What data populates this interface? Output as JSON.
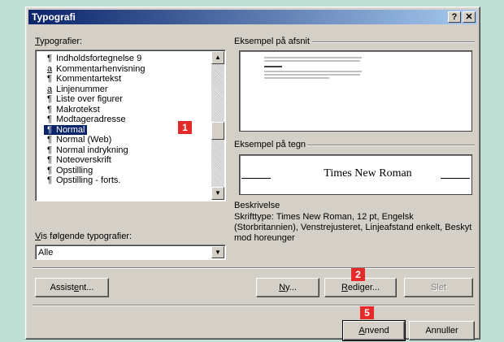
{
  "dialog": {
    "title": "Typografi",
    "help_btn": "?",
    "close_btn": "✕"
  },
  "styles_label_parts": [
    "T",
    "ypografier:"
  ],
  "style_list": [
    {
      "symbol": "¶",
      "name": "Indholdsfortegnelse 9"
    },
    {
      "symbol": "a",
      "name": "Kommentarhenvisning"
    },
    {
      "symbol": "¶",
      "name": "Kommentartekst"
    },
    {
      "symbol": "a",
      "name": "Linjenummer"
    },
    {
      "symbol": "¶",
      "name": "Liste over figurer"
    },
    {
      "symbol": "¶",
      "name": "Makrotekst"
    },
    {
      "symbol": "¶",
      "name": "Modtageradresse"
    },
    {
      "symbol": "¶",
      "name": "Normal"
    },
    {
      "symbol": "¶",
      "name": "Normal (Web)"
    },
    {
      "symbol": "¶",
      "name": "Normal indrykning"
    },
    {
      "symbol": "¶",
      "name": "Noteoverskrift"
    },
    {
      "symbol": "¶",
      "name": "Opstilling"
    },
    {
      "symbol": "¶",
      "name": "Opstilling - forts."
    }
  ],
  "selected_index": 7,
  "paragraph_preview_label": "Eksempel på afsnit",
  "char_preview_label": "Eksempel på tegn",
  "char_preview_text": "Times New Roman",
  "description_label": "Beskrivelse",
  "description_text": "Skrifttype: Times New Roman, 12 pt, Engelsk (Storbritannien), Venstrejusteret, Linjeafstand enkelt, Beskyt mod horeunger",
  "show_label_parts": [
    "V",
    "is følgende typografier:"
  ],
  "show_value": "Alle",
  "buttons": {
    "assistant": [
      "Assist",
      "e",
      "nt..."
    ],
    "new": [
      "N",
      "y..."
    ],
    "edit": [
      "R",
      "ediger..."
    ],
    "delete": "Slet",
    "apply": [
      "A",
      "nvend"
    ],
    "cancel": "Annuller"
  },
  "badges": {
    "b1": "1",
    "b2": "2",
    "b5": "5"
  },
  "colors": {
    "title_start": "#0a246a",
    "title_end": "#a6caf0",
    "badge": "#e52a2a",
    "backdrop": "#bfe0d4"
  },
  "icons": {
    "scroll_up": "▲",
    "scroll_down": "▼",
    "combo_arrow": "▼"
  }
}
